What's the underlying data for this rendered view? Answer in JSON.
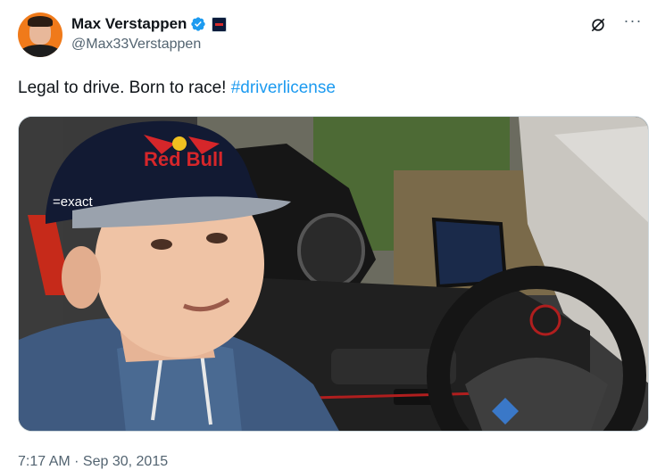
{
  "author": {
    "display_name": "Max Verstappen",
    "handle": "@Max33Verstappen",
    "verified": true,
    "verified_color": "#1d9bf0"
  },
  "tweet": {
    "text": "Legal to drive. Born to race! ",
    "hashtag": "#driverlicense",
    "hashtag_color": "#1d9bf0"
  },
  "media": {
    "cap_logo_text": "Red Bull",
    "cap_side_text": "=exact"
  },
  "meta": {
    "timestamp": "7:17 AM · Sep 30, 2015"
  },
  "icons": {
    "verified": "verified-badge-icon",
    "affiliation": "affiliation-badge-icon",
    "grok": "grok-icon",
    "more": "more-options-icon"
  }
}
